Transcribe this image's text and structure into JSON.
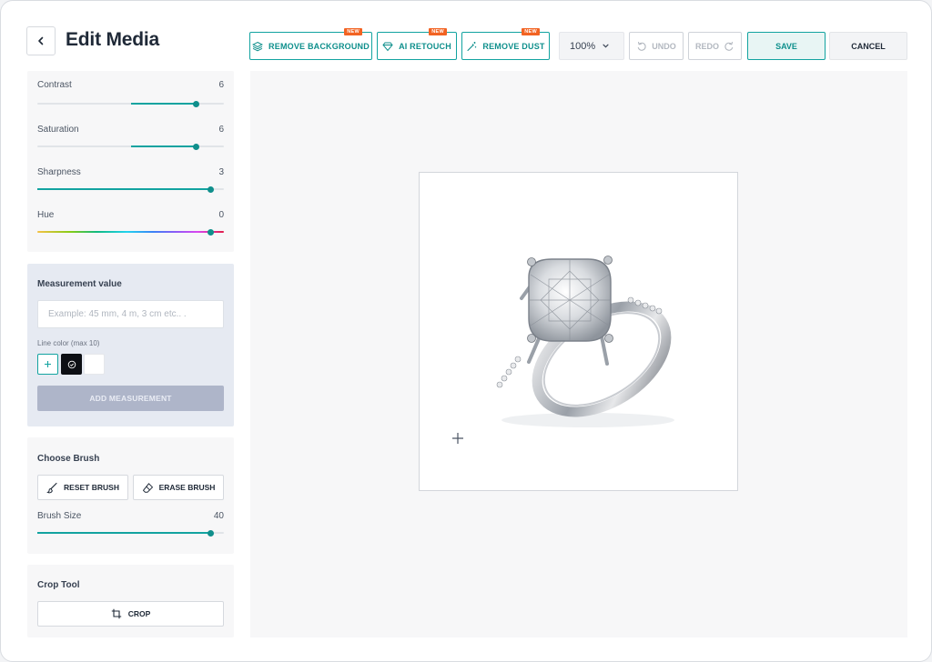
{
  "header": {
    "title": "Edit Media",
    "back_icon": "chevron-left-icon"
  },
  "toolbar": {
    "remove_background": {
      "label": "REMOVE BACKGROUND",
      "badge": "NEW",
      "icon": "layers-icon"
    },
    "ai_retouch": {
      "label": "AI RETOUCH",
      "badge": "NEW",
      "icon": "diamond-icon"
    },
    "remove_dust": {
      "label": "REMOVE DUST",
      "badge": "NEW",
      "icon": "magic-wand-icon"
    },
    "zoom": {
      "value": "100%",
      "icon": "chevron-down-icon"
    },
    "undo": {
      "label": "UNDO",
      "icon": "undo-icon"
    },
    "redo": {
      "label": "REDO",
      "icon": "redo-icon"
    },
    "save_label": "SAVE",
    "cancel_label": "CANCEL"
  },
  "adjustments": [
    {
      "label": "Contrast",
      "value": "6",
      "level": 0.85,
      "fill_from": 0.5
    },
    {
      "label": "Saturation",
      "value": "6",
      "level": 0.85,
      "fill_from": 0.5
    },
    {
      "label": "Sharpness",
      "value": "3",
      "level": 0.93,
      "fill_from": 0
    },
    {
      "label": "Hue",
      "value": "0",
      "level": 0.93,
      "hue": true
    }
  ],
  "measurement": {
    "heading": "Measurement value",
    "placeholder": "Example: 45 mm, 4 m, 3 cm etc.. .",
    "line_color_label": "Line color (max 10)",
    "colors": [
      "#0d0f14",
      "#ffffff"
    ],
    "add_button": "ADD MEASUREMENT"
  },
  "brush": {
    "heading": "Choose Brush",
    "reset_label": "RESET BRUSH",
    "erase_label": "ERASE BRUSH",
    "size_label": "Brush Size",
    "size_value": "40",
    "size_level": 0.93
  },
  "crop": {
    "heading": "Crop Tool",
    "button_label": "CROP"
  },
  "colors": {
    "accent": "#12a3a0",
    "badge": "#f26322",
    "disabled_button": "#aeb5c9"
  }
}
